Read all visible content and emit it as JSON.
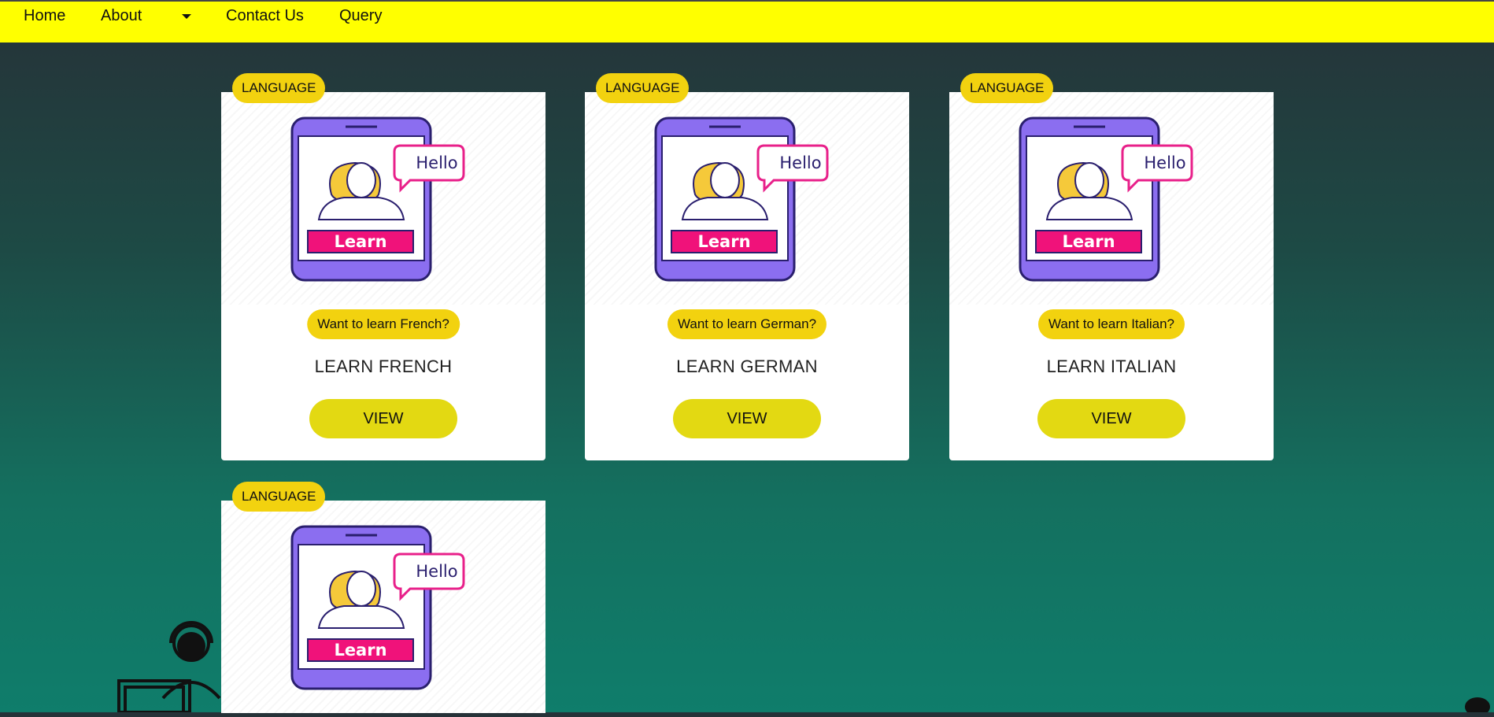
{
  "nav": {
    "items": [
      "Home",
      "About",
      "Contact Us",
      "Query"
    ],
    "dropdown_icon": "caret-down-icon"
  },
  "cards": [
    {
      "badge": "LANGUAGE",
      "tagline": "Want to learn French?",
      "title": "LEARN FRENCH",
      "button": "VIEW",
      "image": {
        "greeting": "Hello",
        "label": "Learn"
      }
    },
    {
      "badge": "LANGUAGE",
      "tagline": "Want to learn German?",
      "title": "LEARN GERMAN",
      "button": "VIEW",
      "image": {
        "greeting": "Hello",
        "label": "Learn"
      }
    },
    {
      "badge": "LANGUAGE",
      "tagline": "Want to learn Italian?",
      "title": "LEARN ITALIAN",
      "button": "VIEW",
      "image": {
        "greeting": "Hello",
        "label": "Learn"
      }
    },
    {
      "badge": "LANGUAGE",
      "image": {
        "greeting": "Hello",
        "label": "Learn"
      }
    }
  ],
  "colors": {
    "navbar": "#ffff00",
    "badge": "#f2d20f",
    "button": "#e3d912",
    "phone": "#8b6ef0",
    "learn_banner": "#f0127a",
    "hello_border": "#e8208a"
  }
}
